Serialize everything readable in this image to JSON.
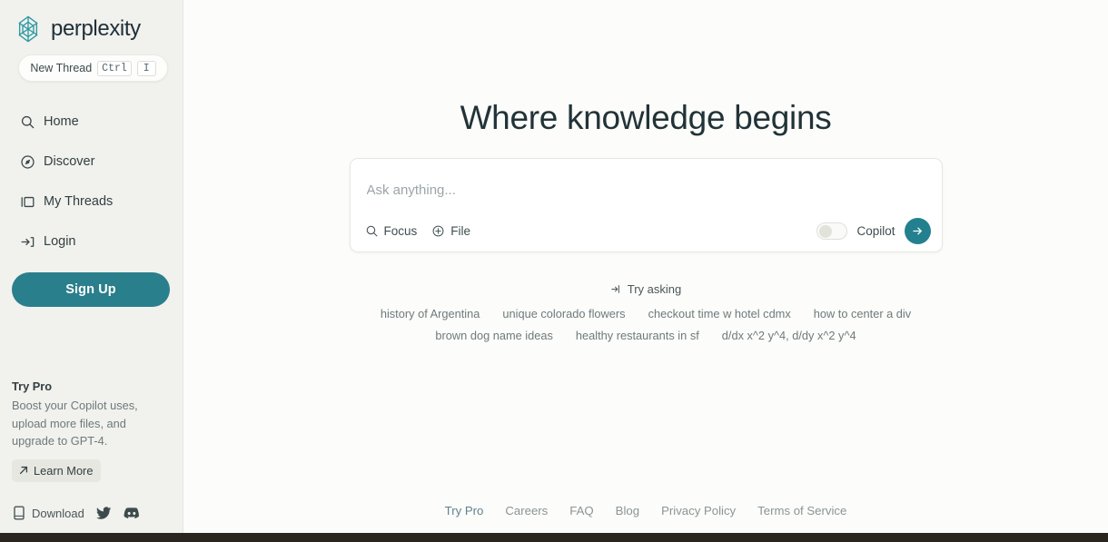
{
  "brand": {
    "name": "perplexity",
    "logo_icon": "perplexity-star-icon",
    "accent_color": "#23808E",
    "sidebar_bg": "#F1F1ED",
    "main_bg": "#FCFCFA"
  },
  "sidebar": {
    "new_thread": {
      "label": "New Thread",
      "key_modifier": "Ctrl",
      "key_letter": "I"
    },
    "nav_items": [
      {
        "label": "Home",
        "icon": "search-icon"
      },
      {
        "label": "Discover",
        "icon": "compass-icon"
      },
      {
        "label": "My Threads",
        "icon": "threads-panel-icon"
      },
      {
        "label": "Login",
        "icon": "login-arrow-icon"
      }
    ],
    "signup_label": "Sign Up",
    "try_pro": {
      "title": "Try Pro",
      "description": "Boost your Copilot uses, upload more files, and upgrade to GPT-4.",
      "cta_label": "Learn More",
      "cta_icon": "arrow-up-right-icon"
    },
    "bottom": {
      "download_label": "Download",
      "download_icon": "mobile-device-icon",
      "twitter_icon": "twitter-bird-icon",
      "discord_icon": "discord-icon"
    }
  },
  "main": {
    "headline": "Where knowledge begins",
    "search": {
      "placeholder": "Ask anything...",
      "value": "",
      "focus_label": "Focus",
      "focus_icon": "search-icon",
      "file_label": "File",
      "file_icon": "plus-circle-icon",
      "copilot_label": "Copilot",
      "copilot_enabled": false,
      "submit_icon": "arrow-right-icon"
    },
    "try_asking": {
      "label": "Try asking",
      "icon": "arrow-into-box-icon"
    },
    "suggestions": [
      [
        "history of Argentina",
        "unique colorado flowers",
        "checkout time w hotel cdmx",
        "how to center a div"
      ],
      [
        "brown dog name ideas",
        "healthy restaurants in sf",
        "d/dx x^2 y^4, d/dy x^2 y^4"
      ]
    ],
    "footer_links": [
      {
        "label": "Try Pro",
        "accent": true
      },
      {
        "label": "Careers",
        "accent": false
      },
      {
        "label": "FAQ",
        "accent": false
      },
      {
        "label": "Blog",
        "accent": false
      },
      {
        "label": "Privacy Policy",
        "accent": false
      },
      {
        "label": "Terms of Service",
        "accent": false
      }
    ]
  }
}
